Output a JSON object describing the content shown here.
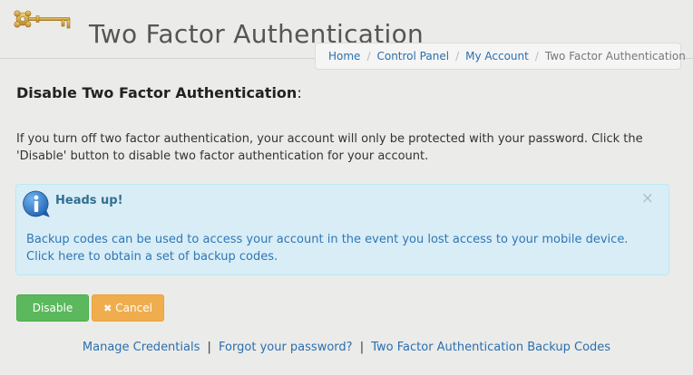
{
  "header": {
    "title": "Two Factor Authentication",
    "logo_icon": "key-icon"
  },
  "breadcrumb": {
    "items": [
      "Home",
      "Control Panel",
      "My Account"
    ],
    "separator": "/",
    "active": "Two Factor Authentication"
  },
  "section": {
    "heading": "Disable Two Factor Authentication",
    "heading_suffix": ":"
  },
  "intro": {
    "line1": "If you turn off two factor authentication, your account will only be protected with your password. Click the",
    "line2": "'Disable' button to disable two factor authentication for your account."
  },
  "alert": {
    "icon": "info-icon",
    "title": "Heads up!",
    "close": "×",
    "line1": "Backup codes can be used to access your account in the event you lost access to your mobile device.",
    "line2": "Click here to obtain a set of backup codes."
  },
  "buttons": {
    "disable": "Disable",
    "cancel_icon": "✖",
    "cancel": "Cancel"
  },
  "footer": {
    "links": [
      "Manage Credentials",
      "Forgot your password?",
      "Two Factor Authentication Backup Codes"
    ],
    "separator": "|"
  },
  "colors": {
    "disable_button": "#5cb85c",
    "cancel_button": "#f0ad4e",
    "alert_background": "#d9edf7",
    "link": "#2a6fb0"
  }
}
